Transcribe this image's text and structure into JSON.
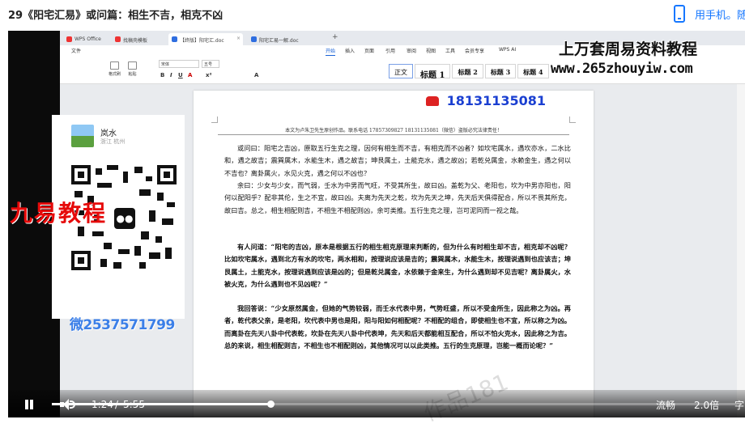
{
  "header": {
    "title": "29《阳宅汇易》或问篇：相生不吉，相克不凶",
    "mobile_label": "用手机。随"
  },
  "wps": {
    "tabs": [
      {
        "label": "WPS Office"
      },
      {
        "label": "找稿壳模板"
      },
      {
        "label": "【终版】阳宅汇.doc"
      },
      {
        "label": "阳宅汇易一解.doc"
      }
    ],
    "menu": [
      "文件",
      "开始",
      "插入",
      "页面",
      "引用",
      "审阅",
      "视图",
      "工具",
      "会员专享",
      "WPS AI"
    ],
    "active_menu": "开始",
    "ribbon": {
      "format_brush": "格式刷",
      "paste": "粘贴",
      "font_name": "宋体",
      "font_size": "五号",
      "styles": [
        "正文",
        "标题 1",
        "标题 2",
        "标题 3",
        "标题 4"
      ]
    }
  },
  "document": {
    "header_line": "本文为卢朱卫先生原创作品。联系电话 17857309827        18131135081（微信）盗版必究法律责任！",
    "paragraphs": [
      {
        "text": "或问曰：阳宅之吉凶，原取五行生克之理，因何有相生而不吉，有相克而不凶者？如坎宅属水，遇坎亦水，二水比和，遇之故吉；震巽属木，水能生木，遇之故吉；坤艮属土，土能克水，遇之故凶；若乾兑属金，水赖金生，遇之何以不吉也？离卦属火，水见火克，遇之何以不凶也？",
        "bold": false
      },
      {
        "text": "余曰：少女与少女，而气弱，壬水为中男而气旺，不受其所生，故曰凶。盖乾为父、老阳也，坎为中男亦阳也，阳何以配阳乎？配非其伦，生之不宜，故曰凶。夫离为先天之乾，坎为先天之坤，先天后天俱得配合，所以不畏其所克，故曰吉。总之，相生相配则吉，不相生不相配则凶，余可类推。五行生克之理，岂可泥同而一视之哉。",
        "bold": false
      },
      {
        "text": "有人问道：“阳宅的吉凶，原本是根据五行的相生相克原理来判断的，但为什么有时相生却不吉，相克却不凶呢？比如坎宅属水，遇到北方有水的坎宅，两水相和，按理说应该是吉的；震巽属木，水能生木，按理说遇到也应该吉；坤艮属土，土能克水，按理说遇到应该是凶的；但是乾兑属金，水依赖于金来生，为什么遇到却不见吉呢？离卦属火，水被火克，为什么遇到也不见凶呢？”",
        "bold": true
      },
      {
        "text": "我回答说：“少女原然属金，但她的气势较弱，而壬水代表中男，气势旺盛，所以不受金所生，因此称之为凶。再者，乾代表父亲，是老阳，坎代表中男也是阳，阳与阳如何相配呢？不相配的组合，即使相生也不宜，所以称之为凶。而离卦在先天八卦中代表乾，坎卦在先天八卦中代表坤，先天和后天都能相互配合，所以不怕火克水，因此称之为吉。总的来说，相生相配则吉，不相生也不相配则凶，其他情况可以以此类推。五行的生克原理，岂能一概而论呢？”",
        "bold": true
      }
    ]
  },
  "overlay": {
    "profile_name": "岚水",
    "profile_sub": "浙江 杭州",
    "brand_text": "九易教程",
    "wechat_id": "微2537571799",
    "wm_title": "上万套周易资料教程",
    "wm_url": "www.265zhouyiw.com",
    "wm_phone": "18131135081",
    "wm_faint": "作品181"
  },
  "player": {
    "current_time": "1:24",
    "separator": "/",
    "duration": "5:55",
    "progress_fraction": 0.319,
    "fluency": "流畅",
    "speed": "2.0倍",
    "subtitle": "字"
  }
}
